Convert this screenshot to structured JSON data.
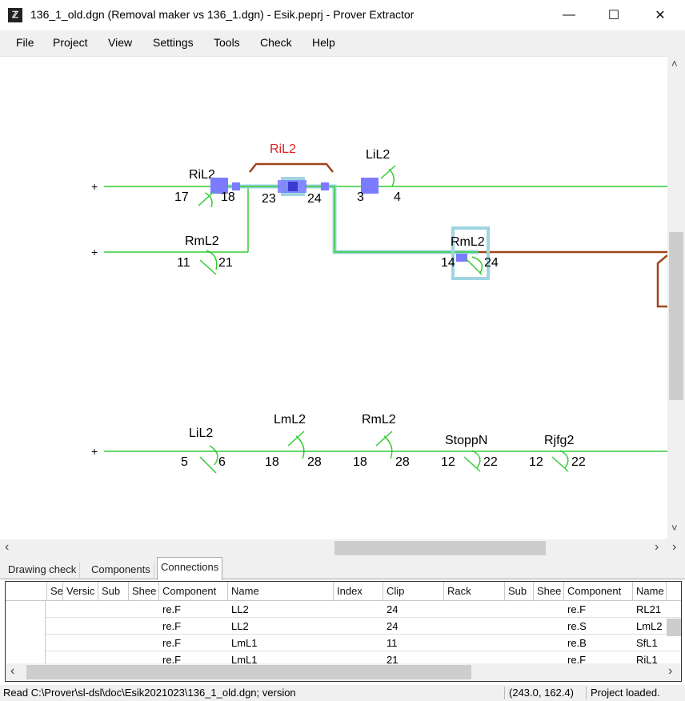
{
  "window": {
    "title": "136_1_old.dgn (Removal maker vs 136_1.dgn) - Esik.peprj - Prover Extractor",
    "icon_text": "ℤ",
    "minimize_icon": "—",
    "maximize_icon": "☐",
    "close_icon": "✕"
  },
  "menu": [
    "File",
    "Project",
    "View",
    "Settings",
    "Tools",
    "Check",
    "Help"
  ],
  "drawing": {
    "plus": "+",
    "top_labels": {
      "ril2_red": "RiL2",
      "ril2_left": "RiL2",
      "lil2_top": "LiL2",
      "rml2_row2": "RmL2",
      "rml2_box": "RmL2"
    },
    "top_numbers": {
      "n17": "17",
      "n18": "18",
      "n23": "23",
      "n24": "24",
      "n3": "3",
      "n4": "4",
      "n11": "11",
      "n21": "21",
      "n14": "14",
      "n24b": "24"
    },
    "bottom_row": [
      {
        "name": "LiL2",
        "left": "5",
        "right": "6"
      },
      {
        "name": "LmL2",
        "left": "18",
        "right": "28"
      },
      {
        "name": "RmL2",
        "left": "18",
        "right": "28"
      },
      {
        "name": "StoppN",
        "left": "12",
        "right": "22"
      },
      {
        "name": "Rjfg2",
        "left": "12",
        "right": "22"
      }
    ]
  },
  "scroll_arrows": {
    "left": "‹",
    "right": "›",
    "up": "˄",
    "down": "˅"
  },
  "tabs": [
    "Drawing check",
    "Components",
    "Connections"
  ],
  "table": {
    "columns": [
      "Se",
      "Versic",
      "Sub",
      "Shee",
      "Component",
      "Name",
      "Index",
      "Clip",
      "Rack",
      "Sub",
      "Shee",
      "Component",
      "Name"
    ],
    "rows": [
      [
        "",
        "",
        "",
        "",
        "re.F",
        "LL2",
        "",
        "24",
        "",
        "",
        "",
        "re.F",
        "RL21"
      ],
      [
        "",
        "",
        "",
        "",
        "re.F",
        "LL2",
        "",
        "24",
        "",
        "",
        "",
        "re.S",
        "LmL2"
      ],
      [
        "",
        "",
        "",
        "",
        "re.F",
        "LmL1",
        "",
        "11",
        "",
        "",
        "",
        "re.B",
        "SfL1"
      ],
      [
        "",
        "",
        "",
        "",
        "re.F",
        "LmL1",
        "",
        "21",
        "",
        "",
        "",
        "re.F",
        "RiL1"
      ]
    ]
  },
  "status": {
    "message": "Read C:\\Prover\\sl-dsl\\doc\\Esik2021023\\136_1_old.dgn; version",
    "coords": "(243.0, 162.4)",
    "state": "Project loaded."
  },
  "colors": {
    "wire": "#33cc33",
    "highlight": "#7b7bff",
    "select": "#9fd5e0",
    "mark_red": "#e02020",
    "bracket": "#a0441a"
  }
}
